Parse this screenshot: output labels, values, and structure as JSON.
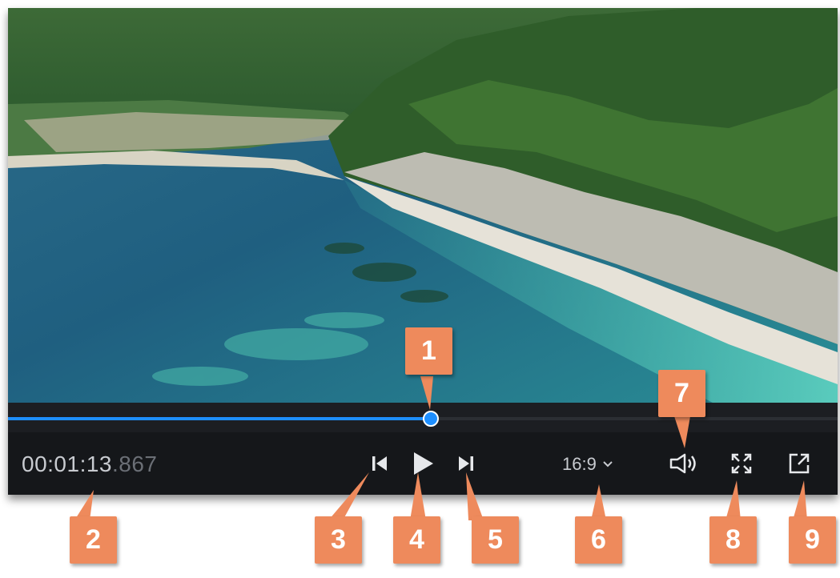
{
  "player": {
    "timecode_main": "00:01:13",
    "timecode_ms": ".867",
    "progress_fraction": 0.51,
    "accent_color": "#1e8fff",
    "aspect_ratio": "16:9",
    "icons": {
      "prev": "skip-back-icon",
      "play": "play-icon",
      "next": "skip-forward-icon",
      "aspect_dropdown": "chevron-down-icon",
      "volume": "volume-icon",
      "fullscreen": "fullscreen-icon",
      "detach": "external-window-icon"
    }
  },
  "callouts": [
    "1",
    "2",
    "3",
    "4",
    "5",
    "6",
    "7",
    "8",
    "9"
  ],
  "callout_color": "#ee8a5c"
}
